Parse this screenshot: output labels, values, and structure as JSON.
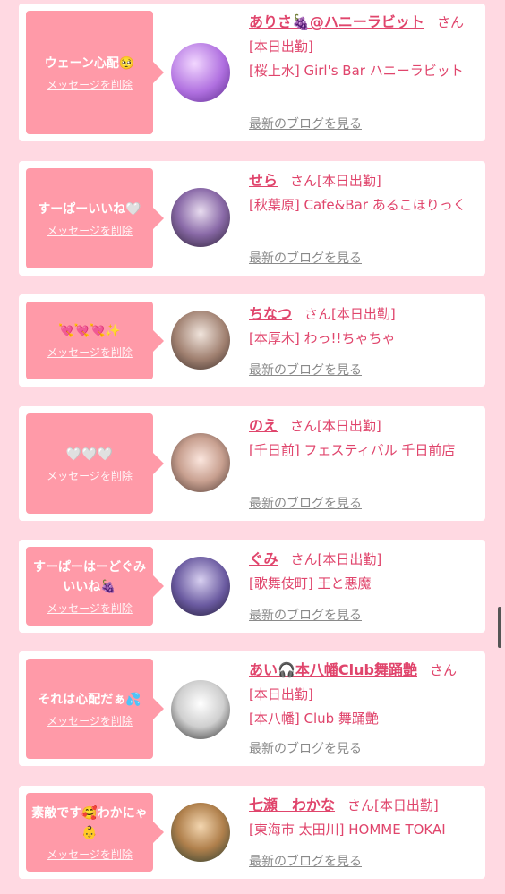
{
  "cards": [
    {
      "message": "ウェーン心配🥺",
      "delete_label": "メッセージを削除",
      "name": "ありさ🍇@ハニーラビット",
      "honorific": "さん",
      "status": "[本日出勤]",
      "shop": "[桜上水] Girl's Bar ハニーラビット",
      "blog_label": "最新のブログを見る",
      "avatar_colors": [
        "#d8b4f0",
        "#7a3fb0"
      ]
    },
    {
      "message": "すーぱーいいね🤍",
      "delete_label": "メッセージを削除",
      "name": "せら",
      "honorific": "さん",
      "status": "[本日出勤]",
      "shop": "[秋葉原] Cafe&Bar あるこほりっく",
      "blog_label": "最新のブログを見る",
      "avatar_colors": [
        "#9b7fb8",
        "#3a2b44"
      ]
    },
    {
      "message": "💘💘💘✨",
      "delete_label": "メッセージを削除",
      "name": "ちなつ",
      "honorific": "さん",
      "status": "[本日出勤]",
      "shop": "[本厚木] わっ!!ちゃちゃ",
      "blog_label": "最新のブログを見る",
      "avatar_colors": [
        "#d9c9bd",
        "#6c5a50"
      ]
    },
    {
      "message": "🤍🤍🤍",
      "delete_label": "メッセージを削除",
      "name": "のえ",
      "honorific": "さん",
      "status": "[本日出勤]",
      "shop": "[千日前] フェスティバル 千日前店",
      "blog_label": "最新のブログを見る",
      "avatar_colors": [
        "#f3dcd3",
        "#7b5a4e"
      ]
    },
    {
      "message": "すーぱーはーどぐみいいね🍇",
      "delete_label": "メッセージを削除",
      "name": "ぐみ",
      "honorific": "さん",
      "status": "[本日出勤]",
      "shop": "[歌舞伎町] 王と悪魔",
      "blog_label": "最新のブログを見る",
      "avatar_colors": [
        "#8a7fc0",
        "#2a2440"
      ]
    },
    {
      "message": "それは心配だぁ💦",
      "delete_label": "メッセージを削除",
      "name": "あい🎧本八幡Club舞踊艶",
      "honorific": "さん",
      "status": "[本日出勤]",
      "shop": "[本八幡] Club 舞踊艶",
      "blog_label": "最新のブログを見る",
      "avatar_colors": [
        "#eeeeee",
        "#3a3a3a"
      ]
    },
    {
      "message": "素敵です🥰わかにゃ👶",
      "delete_label": "メッセージを削除",
      "name": "七瀬　わかな",
      "honorific": "さん",
      "status": "[本日出勤]",
      "shop": "[東海市 太田川] HOMME TOKAI",
      "blog_label": "最新のブログを見る",
      "avatar_colors": [
        "#c9a070",
        "#2e4a3a"
      ]
    }
  ]
}
